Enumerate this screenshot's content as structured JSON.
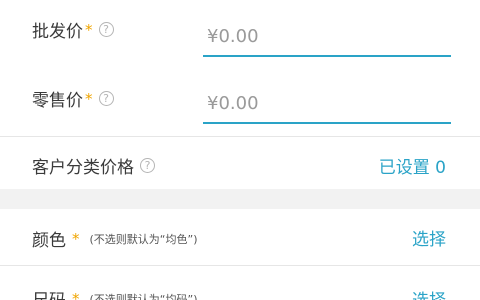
{
  "wholesale": {
    "label": "批发价",
    "required_mark": "*",
    "help": "?",
    "placeholder": "¥0.00"
  },
  "retail": {
    "label": "零售价",
    "required_mark": "*",
    "help": "?",
    "placeholder": "¥0.00"
  },
  "customer_pricing": {
    "label": "客户分类价格",
    "help": "?",
    "status": "已设置 0"
  },
  "color": {
    "label": "颜色",
    "required_mark": "*",
    "hint": "(不选则默认为“均色”)",
    "action": "选择"
  },
  "size": {
    "label": "尺码",
    "required_mark": "*",
    "hint": "(不选则默认为“均码”)",
    "action": "选择"
  },
  "colors": {
    "accent": "#2aa3c7",
    "required": "#f0a500",
    "section_gap": "#f2f2f2"
  }
}
